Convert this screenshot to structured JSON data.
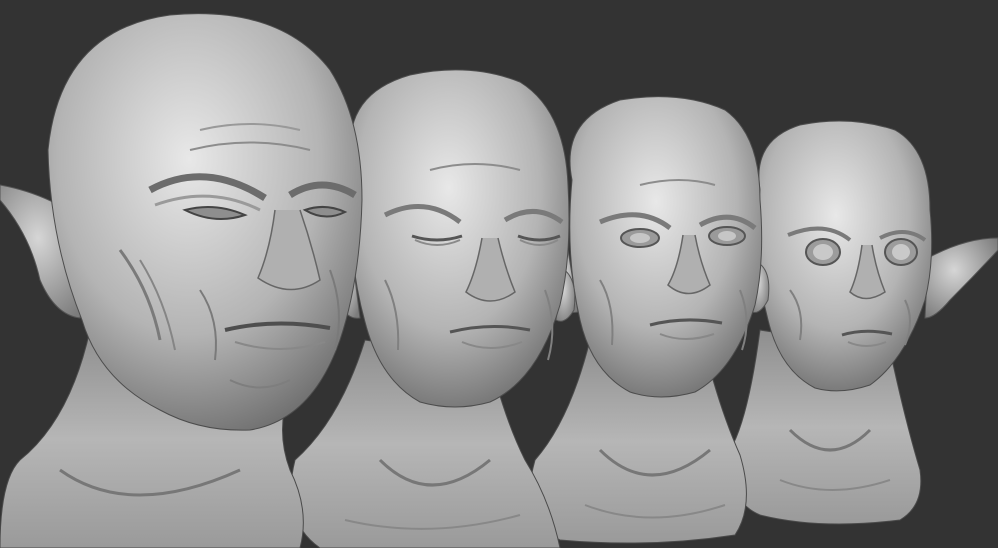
{
  "scene": {
    "background_color": "#333333",
    "material_color": "#b9b9b9",
    "shadow_color": "#5a5a5a",
    "highlight_color": "#e6e6e6",
    "busts": [
      {
        "name": "bust-1",
        "ears": "pointed",
        "eyes": "squinting"
      },
      {
        "name": "bust-2",
        "ears": "small",
        "eyes": "closed"
      },
      {
        "name": "bust-3",
        "ears": "small",
        "eyes": "open"
      },
      {
        "name": "bust-4",
        "ears": "pointed",
        "eyes": "wide-open"
      }
    ]
  }
}
